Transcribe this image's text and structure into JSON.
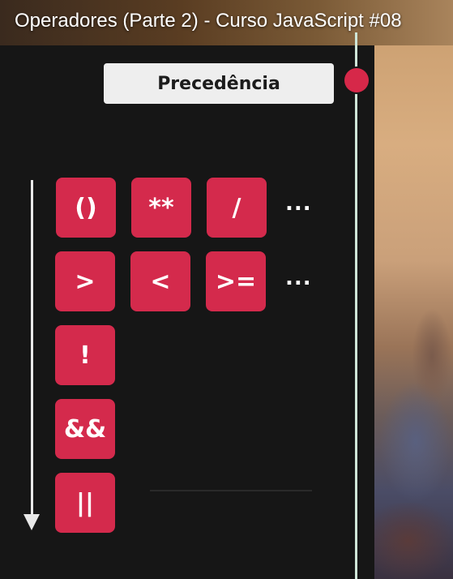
{
  "video": {
    "title": "Operadores (Parte 2) - Curso JavaScript #08"
  },
  "slide": {
    "heading": "Precedência",
    "rows": [
      {
        "operators": [
          "()",
          "**",
          "/"
        ],
        "more": "..."
      },
      {
        "operators": [
          ">",
          "<",
          ">="
        ],
        "more": "..."
      },
      {
        "operators": [
          "!"
        ]
      },
      {
        "operators": [
          "&&"
        ]
      },
      {
        "operators": [
          "||"
        ]
      }
    ]
  },
  "colors": {
    "tile": "#d42a4c",
    "dot": "#d62849",
    "panel": "#161616"
  }
}
